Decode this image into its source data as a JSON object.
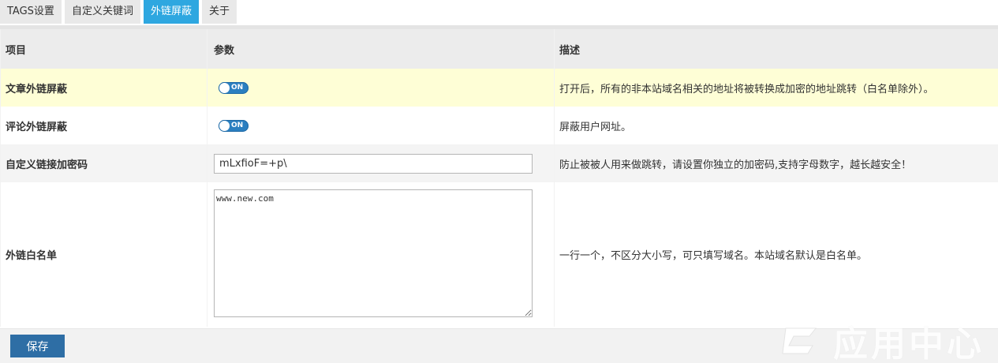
{
  "tabs": [
    {
      "label": "TAGS设置",
      "active": false
    },
    {
      "label": "自定义关键词",
      "active": false
    },
    {
      "label": "外链屏蔽",
      "active": true
    },
    {
      "label": "关于",
      "active": false
    }
  ],
  "table": {
    "headers": {
      "item": "项目",
      "param": "参数",
      "desc": "描述"
    },
    "rows": [
      {
        "label": "文章外链屏蔽",
        "toggle": "ON",
        "desc": "打开后，所有的非本站域名相关的地址将被转换成加密的地址跳转（白名单除外）。"
      },
      {
        "label": "评论外链屏蔽",
        "toggle": "ON",
        "desc": "屏蔽用户网址。"
      },
      {
        "label": "自定义链接加密码",
        "value": "mLxfioF=+p\\",
        "desc": "防止被被人用来做跳转，请设置你独立的加密码,支持字母数字，越长越安全！"
      },
      {
        "label": "外链白名单",
        "value": "www.new.com",
        "desc": "一行一个，不区分大小写，可只填写域名。本站域名默认是白名单。"
      }
    ]
  },
  "footer": {
    "save_label": "保存"
  },
  "watermark": {
    "text": "应用中心"
  },
  "colors": {
    "accent": "#2ea7e0",
    "button": "#2e6ea5",
    "highlight_row": "#fefed6",
    "toggle": "#2b7fc0"
  }
}
